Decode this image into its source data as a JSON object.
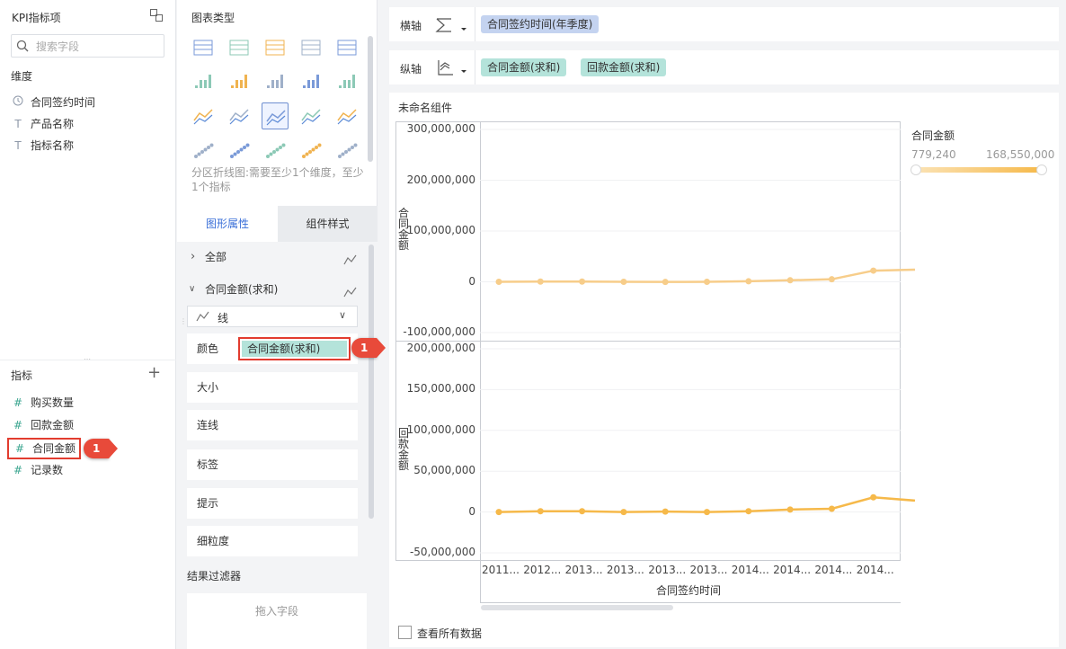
{
  "left_panel": {
    "title": "KPI指标项",
    "search_placeholder": "搜索字段",
    "dimension_heading": "维度",
    "dimensions": [
      {
        "icon": "clock-icon",
        "label": "合同签约时间"
      },
      {
        "icon": "text-type-icon",
        "label": "产品名称"
      },
      {
        "icon": "text-type-icon",
        "label": "指标名称"
      }
    ],
    "metric_heading": "指标",
    "metrics": [
      {
        "icon": "number-type-icon",
        "label": "购买数量"
      },
      {
        "icon": "number-type-icon",
        "label": "回款金额"
      },
      {
        "icon": "number-type-icon",
        "label": "合同金额"
      },
      {
        "icon": "number-type-icon",
        "label": "记录数"
      }
    ]
  },
  "middle_panel": {
    "chart_type_heading": "图表类型",
    "chart_type_hint": "分区折线图:需要至少1个维度，至少1个指标",
    "tabs": [
      "图形属性",
      "组件样式"
    ],
    "all_label": "全部",
    "series_label": "合同金额(求和)",
    "mark_type": "线",
    "props": [
      "颜色",
      "大小",
      "连线",
      "标签",
      "提示",
      "细粒度"
    ],
    "color_pill": "合同金额(求和)",
    "filter_heading": "结果过滤器",
    "filter_drop": "拖入字段"
  },
  "axes": {
    "x_label": "横轴",
    "x_field": "合同签约时间(年季度)",
    "y_label": "纵轴",
    "y_fields": [
      "合同金额(求和)",
      "回款金额(求和)"
    ]
  },
  "chart_panel": {
    "title": "未命名组件",
    "show_all_label": "查看所有数据",
    "legend_title": "合同金额",
    "legend_min": "779,240",
    "legend_max": "168,550,000"
  },
  "annotations": [
    "1",
    "1"
  ],
  "colors": {
    "accent": "#3a6fd8",
    "pill_teal": "#b4e3da",
    "pill_blue": "#c4d3f0",
    "line_top": "#f7cd8a",
    "line_bottom": "#f6b94a",
    "badge": "#e84a3a"
  },
  "chart_data": [
    {
      "type": "line",
      "title": "",
      "ylabel": "合同金额",
      "xlabel": "",
      "ylim": [
        -100000000,
        300000000
      ],
      "y_ticks": [
        "300,000,000",
        "200,000,000",
        "100,000,000",
        "0",
        "-100,000,000"
      ],
      "categories": [
        "2011...",
        "2012...",
        "2013...",
        "2013...",
        "2013...",
        "2013...",
        "2014...",
        "2014...",
        "2014...",
        "2014...",
        ""
      ],
      "series": [
        {
          "values": [
            0,
            500000,
            500000,
            0,
            -300000,
            0,
            1000000,
            3000000,
            5000000,
            22000000,
            24000000
          ]
        }
      ]
    },
    {
      "type": "line",
      "title": "",
      "ylabel": "回款金额",
      "xlabel": "合同签约时间",
      "ylim": [
        -50000000,
        200000000
      ],
      "y_ticks": [
        "200,000,000",
        "150,000,000",
        "100,000,000",
        "50,000,000",
        "0",
        "-50,000,000"
      ],
      "categories": [
        "2011...",
        "2012...",
        "2013...",
        "2013...",
        "2013...",
        "2013...",
        "2014...",
        "2014...",
        "2014...",
        "2014...",
        ""
      ],
      "series": [
        {
          "values": [
            0,
            1000000,
            1000000,
            0,
            500000,
            0,
            1000000,
            3000000,
            4000000,
            18000000,
            14000000
          ]
        }
      ]
    }
  ]
}
